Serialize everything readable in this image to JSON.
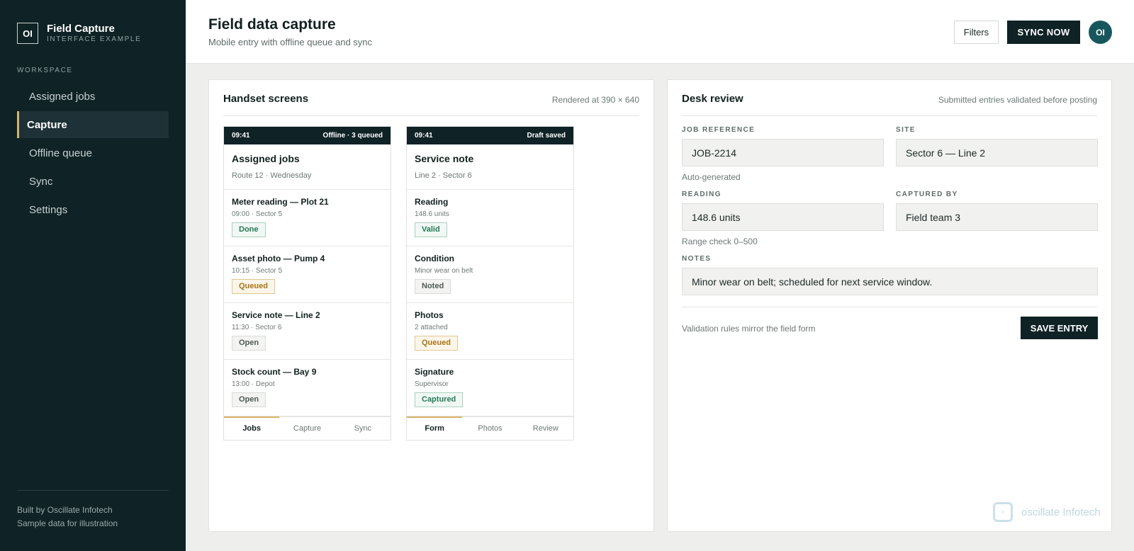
{
  "sidebar": {
    "brand_mark": "OI",
    "brand_name": "Field Capture",
    "brand_sub": "INTERFACE EXAMPLE",
    "section_label": "WORKSPACE",
    "items": [
      {
        "label": "Assigned jobs"
      },
      {
        "label": "Capture",
        "active": true
      },
      {
        "label": "Offline queue"
      },
      {
        "label": "Sync"
      },
      {
        "label": "Settings"
      }
    ],
    "footer_line1": "Built by Oscillate Infotech",
    "footer_line2": "Sample data for illustration"
  },
  "header": {
    "title": "Field data capture",
    "subtitle": "Mobile entry with offline queue and sync",
    "filters_label": "Filters",
    "sync_label": "SYNC NOW",
    "avatar_initials": "OI"
  },
  "handset": {
    "title": "Handset screens",
    "meta": "Rendered at 390 × 640",
    "phone_a": {
      "time": "09:41",
      "status": "Offline · 3 queued",
      "title": "Assigned jobs",
      "subtitle": "Route 12 · Wednesday",
      "items": [
        {
          "title": "Meter reading — Plot 21",
          "meta": "09:00 · Sector 5",
          "badge": "Done"
        },
        {
          "title": "Asset photo — Pump 4",
          "meta": "10:15 · Sector 5",
          "badge": "Queued"
        },
        {
          "title": "Service note — Line 2",
          "meta": "11:30 · Sector 6",
          "badge": "Open"
        },
        {
          "title": "Stock count — Bay 9",
          "meta": "13:00 · Depot",
          "badge": "Open"
        }
      ],
      "tabs": [
        "Jobs",
        "Capture",
        "Sync"
      ]
    },
    "phone_b": {
      "time": "09:41",
      "status": "Draft saved",
      "title": "Service note",
      "subtitle": "Line 2 · Sector 6",
      "items": [
        {
          "title": "Reading",
          "meta": "148.6 units",
          "badge": "Valid"
        },
        {
          "title": "Condition",
          "meta": "Minor wear on belt",
          "badge": "Noted"
        },
        {
          "title": "Photos",
          "meta": "2 attached",
          "badge": "Queued"
        },
        {
          "title": "Signature",
          "meta": "Supervisor",
          "badge": "Captured"
        }
      ],
      "tabs": [
        "Form",
        "Photos",
        "Review"
      ]
    }
  },
  "desk": {
    "title": "Desk review",
    "meta": "Submitted entries validated before posting",
    "job_ref_label": "JOB REFERENCE",
    "job_ref_value": "JOB-2214",
    "job_ref_help": "Auto-generated",
    "site_label": "SITE",
    "site_value": "Sector 6 — Line 2",
    "reading_label": "READING",
    "reading_value": "148.6 units",
    "reading_help": "Range check 0–500",
    "captured_label": "CAPTURED BY",
    "captured_value": "Field team 3",
    "notes_label": "NOTES",
    "notes_value": "Minor wear on belt; scheduled for next service window.",
    "footer_note": "Validation rules mirror the field form",
    "save_label": "SAVE ENTRY",
    "watermark": "oscillate Infotech"
  },
  "colors": {
    "sidebar_bg": "#0f2226",
    "accent": "#d8b46a",
    "avatar": "#17575c",
    "badge_green": "#237a54",
    "badge_amber": "#a87416"
  }
}
